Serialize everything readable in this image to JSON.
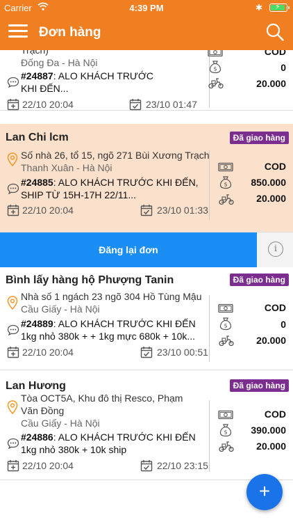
{
  "status_bar": {
    "carrier": "Carrier",
    "time": "4:39 PM"
  },
  "header": {
    "title": "Đơn hàng"
  },
  "orders": [
    {
      "name": "",
      "status": "",
      "address_line1": "Trạch)",
      "address_line2": "Đống Đa - Hà Nội",
      "note_id": "#24887",
      "note_line1_rest": ": ALO KHÁCH TRƯỚC",
      "note_line2": "KHI ĐẾN...",
      "created": "22/10 20:04",
      "delivered": "23/10 01:47",
      "cod": "COD",
      "amount": "0",
      "fee": "20.000"
    },
    {
      "name": "Lan Chi lcm",
      "status": "Đã giao hàng",
      "address_line1": "Số nhà 26, tổ 15, ngõ 271 Bùi Xương Trạch",
      "address_line2": "Thanh Xuân - Hà Nội",
      "note_id": "#24885",
      "note_line1_rest": ": ALO KHÁCH TRƯỚC KHI ĐẾN,",
      "note_line2": "SHIP TỪ 15H-17H 22/11...",
      "created": "22/10 20:04",
      "delivered": "23/10 01:33",
      "cod": "COD",
      "amount": "850.000",
      "fee": "20.000"
    },
    {
      "name": "Bình lấy hàng hộ Phượng Tanin",
      "status": "Đã giao hàng",
      "address_line1": "Nhà số 1 ngách 23 ngõ 304 Hồ Tùng Mậu",
      "address_line2": "Cầu Giấy - Hà Nội",
      "note_id": "#24889",
      "note_line1_rest": ": ALO KHÁCH TRƯỚC KHI ĐẾN",
      "note_line2": "1kg nhỏ 380k + + 1kg mực 680k + 10k...",
      "created": "22/10 20:04",
      "delivered": "23/10 00:51",
      "cod": "COD",
      "amount": "0",
      "fee": "20.000"
    },
    {
      "name": "Lan Hương",
      "status": "Đã giao hàng",
      "address_line1": "Tòa OCT5A, Khu đô thị Resco, Phạm",
      "address_line1b": "Văn Đồng",
      "address_line2": "Cầu Giấy - Hà Nội",
      "note_id": "#24886",
      "note_line1_rest": ": ALO KHÁCH TRƯỚC KHI ĐẾN",
      "note_line2": "1kg nhỏ 380k + 10k ship",
      "created": "22/10 20:04",
      "delivered": "22/10 23:15",
      "cod": "COD",
      "amount": "390.000",
      "fee": "20.000"
    }
  ],
  "action_bar": {
    "relist_label": "Đăng lại đơn",
    "info_glyph": "i"
  },
  "fab": {
    "glyph": "+"
  },
  "icons": [
    "wifi-icon",
    "bluetooth-icon",
    "battery-icon",
    "menu-icon",
    "search-icon",
    "location-pin-icon",
    "chat-note-icon",
    "calendar-add-icon",
    "calendar-check-icon",
    "cash-icon",
    "money-bag-icon",
    "scooter-icon",
    "info-icon",
    "plus-icon"
  ],
  "colors": {
    "header": "#f07f22",
    "badge": "#7b2d90",
    "highlight_row": "#fbe0cc",
    "relist_button": "#1a8ef5",
    "fab": "#1a73e8"
  }
}
